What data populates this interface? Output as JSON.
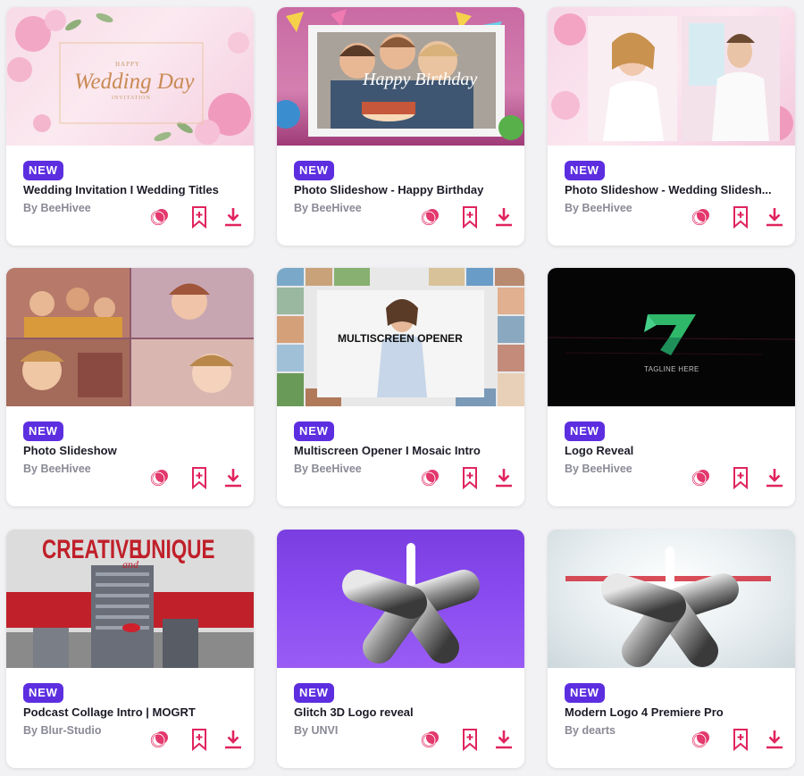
{
  "cards": [
    {
      "badge": "NEW",
      "title": "Wedding Invitation I Wedding Titles",
      "author": "By BeeHivee",
      "thumb_text": {
        "line1": "HAPPY",
        "line2": "Wedding Day",
        "line3": "INVITATION"
      }
    },
    {
      "badge": "NEW",
      "title": "Photo Slideshow - Happy Birthday",
      "author": "By BeeHivee",
      "thumb_text": {
        "line1": "Happy Birthday"
      }
    },
    {
      "badge": "NEW",
      "title": "Photo Slideshow - Wedding Slidesh...",
      "author": "By BeeHivee"
    },
    {
      "badge": "NEW",
      "title": "Photo Slideshow",
      "author": "By BeeHivee"
    },
    {
      "badge": "NEW",
      "title": "Multiscreen Opener I Mosaic Intro",
      "author": "By BeeHivee",
      "thumb_text": {
        "line1": "MULTISCREEN OPENER"
      }
    },
    {
      "badge": "NEW",
      "title": "Logo Reveal",
      "author": "By BeeHivee",
      "thumb_text": {
        "line1": "TAGLINE HERE"
      }
    },
    {
      "badge": "NEW",
      "title": "Podcast Collage Intro | MOGRT",
      "author": "By Blur-Studio",
      "thumb_text": {
        "line1": "CREATIVE",
        "line2": "and",
        "line3": "UNIQUE"
      }
    },
    {
      "badge": "NEW",
      "title": "Glitch 3D Logo reveal",
      "author": "By UNVI"
    },
    {
      "badge": "NEW",
      "title": "Modern Logo 4 Premiere Pro",
      "author": "By dearts"
    }
  ],
  "icons": {
    "compare": "overlap-circles-icon",
    "save": "bookmark-add-icon",
    "download": "download-icon"
  },
  "colors": {
    "badge": "#5c2ee0",
    "action": "#e0245e",
    "title": "#1c1c28",
    "author": "#8a8a96"
  }
}
